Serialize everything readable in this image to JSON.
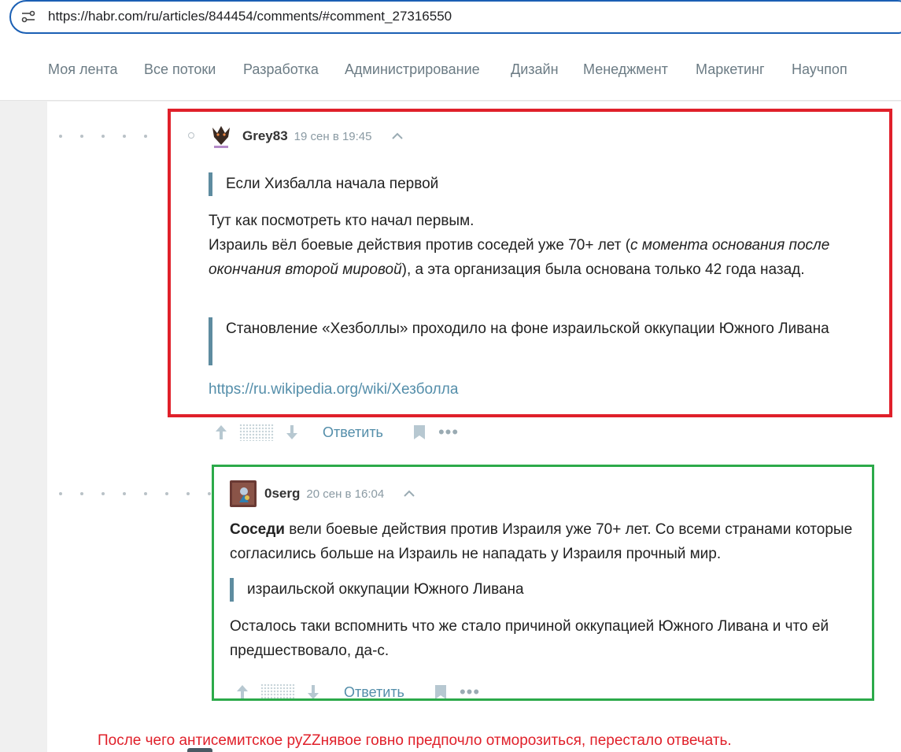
{
  "browser": {
    "url": "https://habr.com/ru/articles/844454/comments/#comment_27316550"
  },
  "nav": {
    "items": [
      "Моя лента",
      "Все потоки",
      "Разработка",
      "Администрирование",
      "Дизайн",
      "Менеджмент",
      "Маркетинг",
      "Научпоп"
    ]
  },
  "comment1": {
    "username": "Grey83",
    "date": "19 сен в 19:45",
    "quote1": "Если Хизбалла начала первой",
    "line1": "Тут как посмотреть кто начал первым.",
    "line2_a": "Израиль вёл боевые действия против соседей уже 70+ лет (",
    "line2_italic": "с момента основания после окончания второй мировой",
    "line2_b": "), а эта организация была основана только 42 года назад.",
    "quote2": "Становление «Хезболлы» проходило на фоне израильской оккупации Южного Ливана",
    "link": "https://ru.wikipedia.org/wiki/Хезболла",
    "reply_label": "Ответить"
  },
  "comment2": {
    "username": "0serg",
    "date": "20 сен в 16:04",
    "bold": "Соседи",
    "text1_rest": " вели боевые действия против Израиля уже 70+ лет. Со всеми странами которые согласились больше на Израиль не нападать у Израиля прочный мир.",
    "quote": "израильской оккупации Южного Ливана",
    "text2": "Осталось таки вспомнить что же стало причиной оккупацией Южного Ливана и что ей предшествовало, да-с.",
    "reply_label": "Ответить"
  },
  "annotation": {
    "note": "После чего антисемитское руZZнявое говно предпочло отморозиться,  перестало отвечать."
  },
  "colors": {
    "red_box": "#e0202a",
    "green_box": "#2caa4a",
    "link": "#548eaa",
    "quote_bar": "#5e8ca0"
  },
  "icons": [
    "site-settings-icon",
    "avatar-grey83",
    "avatar-0serg",
    "chevron-up-icon",
    "arrow-up-icon",
    "arrow-down-icon",
    "bookmark-icon",
    "more-icon"
  ]
}
